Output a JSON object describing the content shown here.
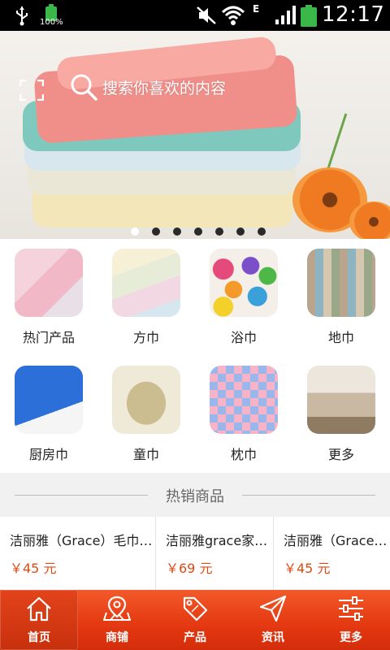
{
  "status_bar": {
    "battery_small_pct": "100%",
    "network_type": "E",
    "time": "12:17"
  },
  "banner": {
    "search_placeholder": "搜索你喜欢的内容",
    "slide_count": 7,
    "active_slide": 1
  },
  "categories": [
    {
      "label": "热门产品"
    },
    {
      "label": "方巾"
    },
    {
      "label": "浴巾"
    },
    {
      "label": "地巾"
    },
    {
      "label": "厨房巾"
    },
    {
      "label": "童巾"
    },
    {
      "label": "枕巾"
    },
    {
      "label": "更多"
    }
  ],
  "hot_section": {
    "title": "热销商品",
    "products": [
      {
        "name": "洁丽雅（Grace）毛巾…",
        "price": "￥45 元"
      },
      {
        "name": "洁丽雅grace家…",
        "price": "￥69 元"
      },
      {
        "name": "洁丽雅（Grace…",
        "price": "￥45 元"
      }
    ]
  },
  "bottom_nav": [
    {
      "label": "首页",
      "icon": "home-icon",
      "active": true
    },
    {
      "label": "商铺",
      "icon": "map-pin-icon",
      "active": false
    },
    {
      "label": "产品",
      "icon": "sale-tag-icon",
      "active": false
    },
    {
      "label": "资讯",
      "icon": "paper-plane-icon",
      "active": false
    },
    {
      "label": "更多",
      "icon": "sliders-icon",
      "active": false
    }
  ],
  "colors": {
    "accent": "#e53a12",
    "price": "#e04a14",
    "battery": "#3bb84a"
  }
}
